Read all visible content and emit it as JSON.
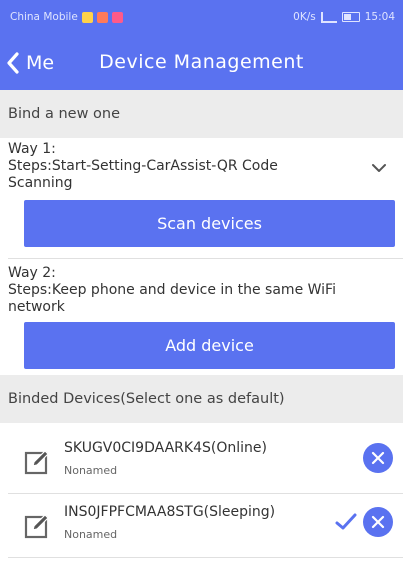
{
  "status_bar": {
    "carrier": "China Mobile",
    "speed": "0K/s",
    "time": "15:04"
  },
  "nav": {
    "back_label": "Me",
    "title": "Device Management"
  },
  "bind_section": {
    "header": "Bind a new one",
    "way1": {
      "title": "Way 1:",
      "steps_line1": "Steps:Start-Setting-CarAssist-QR Code",
      "steps_line2": "Scanning",
      "button_label": "Scan devices"
    },
    "way2": {
      "title": "Way 2:",
      "steps_line1": "Steps:Keep phone and device in the same WiFi",
      "steps_line2": "network",
      "button_label": "Add device"
    }
  },
  "binded_section": {
    "header": "Binded Devices(Select one as default)",
    "devices": [
      {
        "name": "SKUGV0CI9DAARK4S(Online)",
        "alias": "Nonamed",
        "is_default": false
      },
      {
        "name": "INS0JFPFCMAA8STG(Sleeping)",
        "alias": "Nonamed",
        "is_default": true
      }
    ]
  },
  "colors": {
    "accent": "#5a72f0",
    "section_bg": "#ececec"
  },
  "icons": {
    "back": "chevron-left-icon",
    "expand": "chevron-down-icon",
    "edit": "pencil-icon",
    "default": "checkmark-icon",
    "remove": "close-icon"
  }
}
